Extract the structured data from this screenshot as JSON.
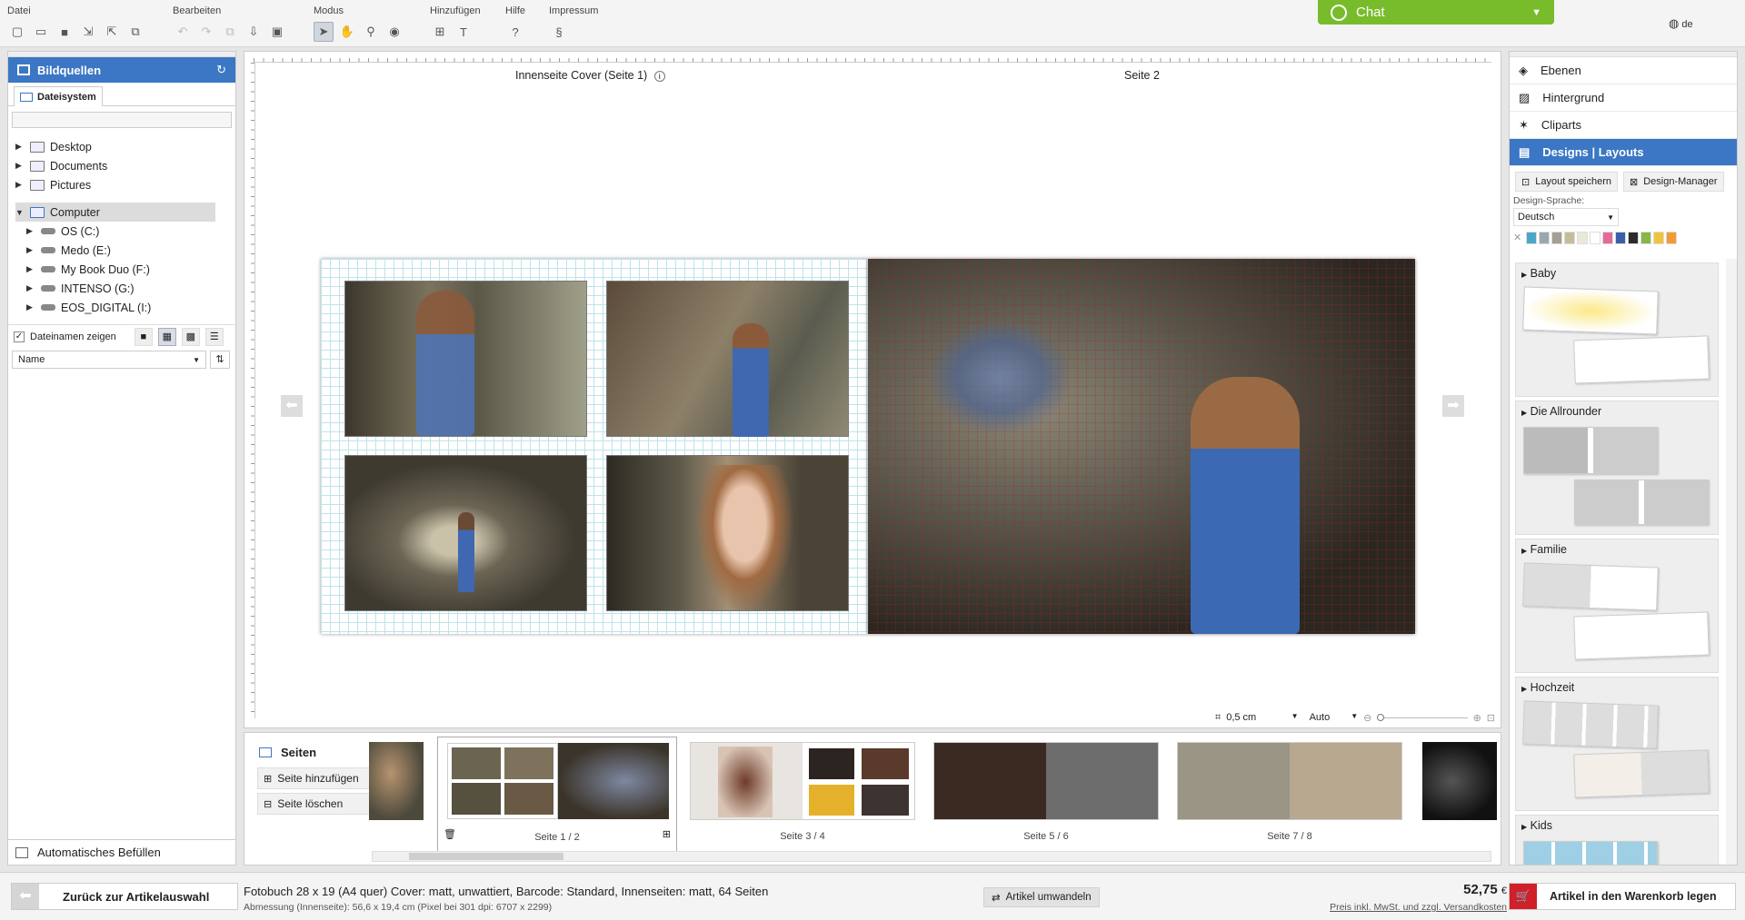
{
  "toolbar": {
    "groups": [
      {
        "label": "Datei"
      },
      {
        "label": "Bearbeiten"
      },
      {
        "label": "Modus"
      },
      {
        "label": "Hinzufügen"
      },
      {
        "label": "Hilfe",
        "icon_text": "?"
      },
      {
        "label": "Impressum",
        "icon_text": "§"
      }
    ]
  },
  "chat": {
    "label": "Chat"
  },
  "language": {
    "label": "de"
  },
  "left_panel": {
    "title": "Bildquellen",
    "tab": "Dateisystem",
    "tree": [
      "Desktop",
      "Documents",
      "Pictures",
      "Computer",
      "OS (C:)",
      "Medo (E:)",
      "My Book Duo (F:)",
      "INTENSO (G:)",
      "EOS_DIGITAL (I:)"
    ],
    "show_filenames": "Dateinamen zeigen",
    "sort_label": "Name",
    "auto_fill": "Automatisches Befüllen"
  },
  "canvas": {
    "left_page_label": "Innenseite Cover (Seite 1)",
    "right_page_label": "Seite 2",
    "grid_size": "0,5 cm",
    "zoom_mode": "Auto"
  },
  "strip": {
    "title": "Seiten",
    "add_page": "Seite hinzufügen",
    "delete_page": "Seite löschen",
    "spreads": [
      "Seite 1 / 2",
      "Seite 3 / 4",
      "Seite 5 / 6",
      "Seite 7 / 8"
    ]
  },
  "right_panel": {
    "items": [
      "Ebenen",
      "Hintergrund",
      "Cliparts",
      "Designs | Layouts"
    ],
    "save_layout": "Layout speichern",
    "design_manager": "Design-Manager",
    "design_lang_label": "Design-Sprache:",
    "design_lang_value": "Deutsch",
    "swatches": [
      "#4ba7c9",
      "#9aa7ae",
      "#a39f93",
      "#c5bd9a",
      "#ece8d8",
      "#ffffff",
      "#e56a9a",
      "#3a5fa8",
      "#2c2c2c",
      "#88b648",
      "#f0c33c",
      "#f29a35"
    ],
    "categories": [
      "Baby",
      "Die Allrounder",
      "Familie",
      "Hochzeit",
      "Kids"
    ]
  },
  "bottom": {
    "back": "Zurück zur Artikelauswahl",
    "product": "Fotobuch 28 x 19 (A4 quer) Cover: matt, unwattiert, Barcode: Standard, Innenseiten: matt, 64 Seiten",
    "dims": "Abmessung (Innenseite): 56,6 x 19,4 cm (Pixel bei 301 dpi: 6707 x 2299)",
    "convert": "Artikel umwandeln",
    "price": "52,75",
    "currency": "€",
    "price_note": "Preis inkl. MwSt. und zzgl. Versandkosten",
    "cart": "Artikel in den Warenkorb legen"
  }
}
